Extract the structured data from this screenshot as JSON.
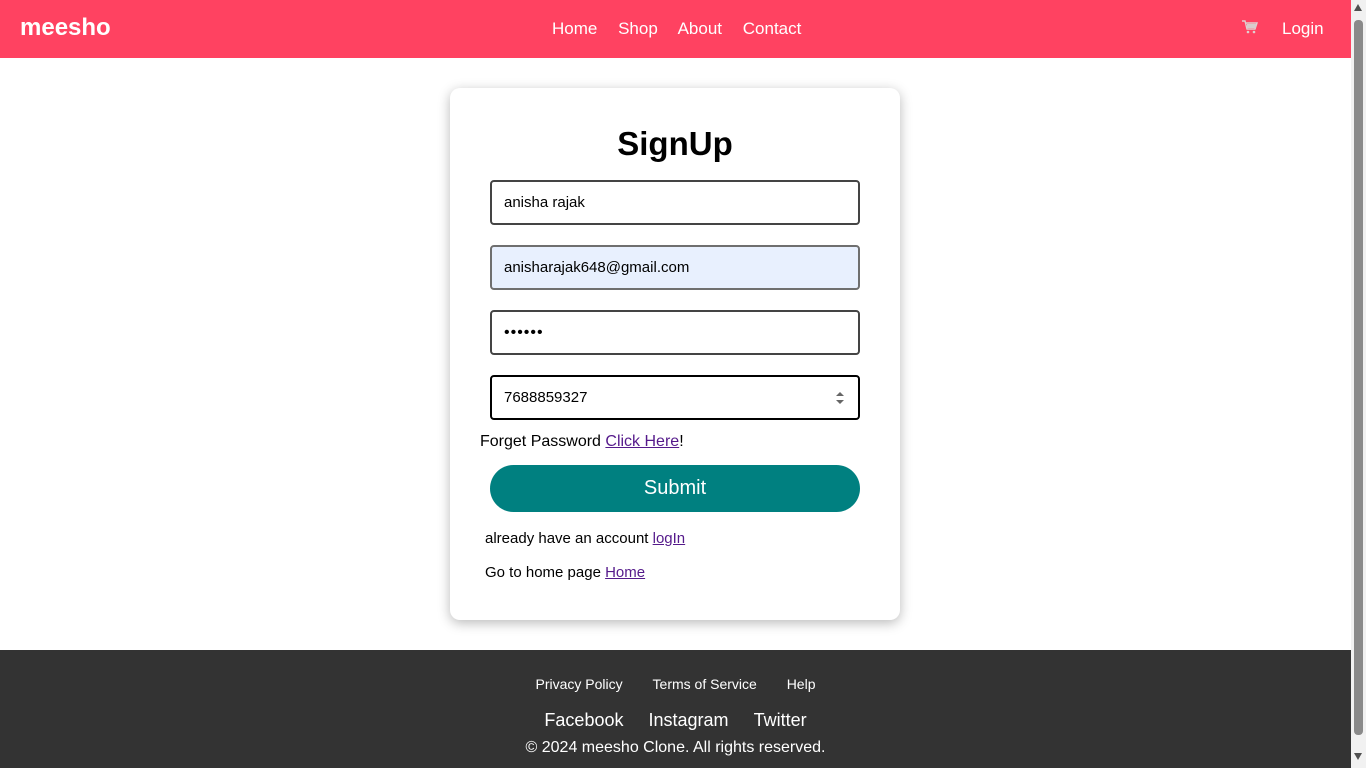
{
  "nav": {
    "brand": "meesho",
    "links": [
      "Home",
      "Shop",
      "About",
      "Contact"
    ],
    "cart_icon": "cart-icon",
    "login": "Login"
  },
  "form": {
    "title": "SignUp",
    "name_value": "anisha rajak",
    "email_value": "anisharajak648@gmail.com",
    "password_value": "••••••",
    "phone_value": "7688859327",
    "forgot_text": "Forget Password",
    "forgot_link": "Click Here",
    "forgot_suffix": "!",
    "submit_label": "Submit",
    "have_account_text": "already have an account",
    "have_account_link": "logIn",
    "go_home_text": "Go to home page",
    "go_home_link": "Home"
  },
  "footer": {
    "links": [
      "Privacy Policy",
      "Terms of Service",
      "Help"
    ],
    "social": [
      "Facebook",
      "Instagram",
      "Twitter"
    ],
    "copyright": "© 2024 meesho Clone. All rights reserved."
  },
  "colors": {
    "navbar": "#ff4261",
    "submit": "#008080",
    "footer": "#333333",
    "autofill": "#e8f0fe"
  }
}
